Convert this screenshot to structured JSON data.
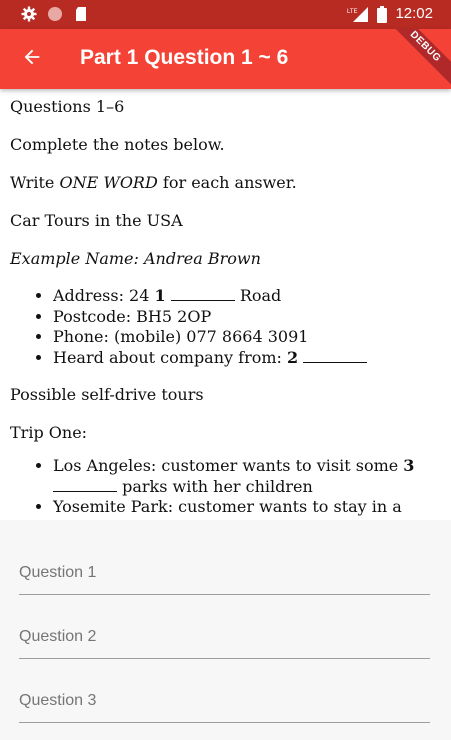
{
  "status_bar": {
    "time": "12:02",
    "network": "LTE",
    "icons": [
      "settings-icon",
      "record-icon",
      "sd-card-icon",
      "signal-icon",
      "battery-icon"
    ]
  },
  "app_bar": {
    "title": "Part 1 Question 1 ~ 6",
    "back_icon": "arrow-back-icon",
    "debug_label": "DEBUG",
    "color": "#f44336",
    "status_color": "#b72b22"
  },
  "content": {
    "heading": "Questions 1–6",
    "instruction": "Complete the notes below.",
    "write_prefix": "Write ",
    "write_emphasis": "ONE WORD",
    "write_suffix": " for each answer.",
    "topic": "Car Tours in the USA",
    "example": "Example Name: Andrea Brown",
    "details": [
      {
        "prefix": "Address: 24 ",
        "number": "1",
        "suffix": " Road"
      },
      {
        "text": "Postcode: BH5 2OP"
      },
      {
        "text": "Phone: (mobile) 077 8664 3091"
      },
      {
        "prefix": "Heard about company from: ",
        "number": "2",
        "suffix": ""
      }
    ],
    "section": "Possible self-drive tours",
    "trip": "Trip One:",
    "trip_items": [
      {
        "prefix": "Los Angeles: customer wants to visit some ",
        "number": "3",
        "suffix": " parks with her children"
      },
      {
        "text": "Yosemite Park: customer wants to stay in a"
      }
    ]
  },
  "answers": {
    "placeholders": [
      "Question 1",
      "Question 2",
      "Question 3"
    ],
    "values": [
      "",
      "",
      ""
    ]
  }
}
